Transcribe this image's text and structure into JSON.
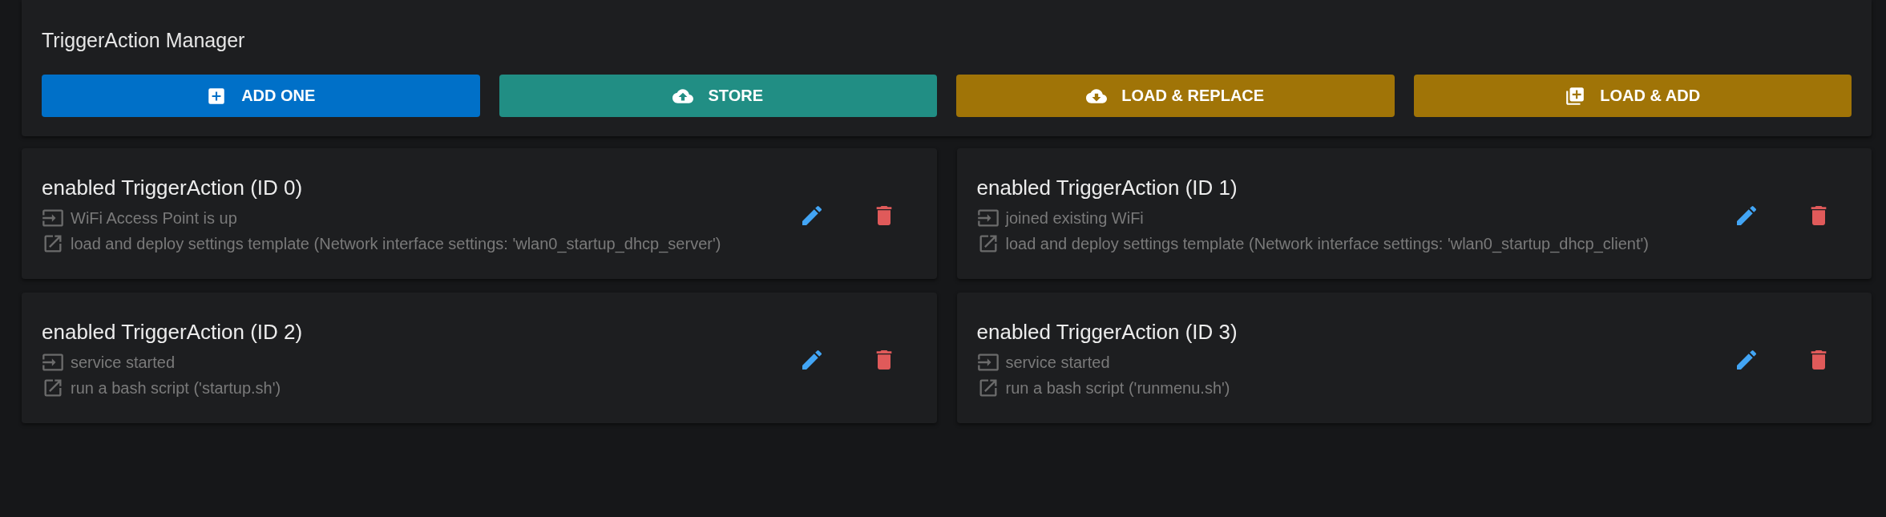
{
  "header": {
    "title": "TriggerAction Manager",
    "buttons": [
      {
        "label": "ADD ONE",
        "kind": "add",
        "color": "#0070c8"
      },
      {
        "label": "STORE",
        "kind": "upload",
        "color": "#218e84"
      },
      {
        "label": "LOAD & REPLACE",
        "kind": "download",
        "color": "#a07407"
      },
      {
        "label": "LOAD & ADD",
        "kind": "library-add",
        "color": "#a07407"
      }
    ]
  },
  "cards": [
    {
      "title": "enabled TriggerAction (ID 0)",
      "trigger": "WiFi Access Point is up",
      "action": "load and deploy settings template (Network interface settings: 'wlan0_startup_dhcp_server')"
    },
    {
      "title": "enabled TriggerAction (ID 1)",
      "trigger": "joined existing WiFi",
      "action": "load and deploy settings template (Network interface settings: 'wlan0_startup_dhcp_client')"
    },
    {
      "title": "enabled TriggerAction (ID 2)",
      "trigger": "service started",
      "action": "run a bash script ('startup.sh')"
    },
    {
      "title": "enabled TriggerAction (ID 3)",
      "trigger": "service started",
      "action": "run a bash script ('runmenu.sh')"
    }
  ]
}
